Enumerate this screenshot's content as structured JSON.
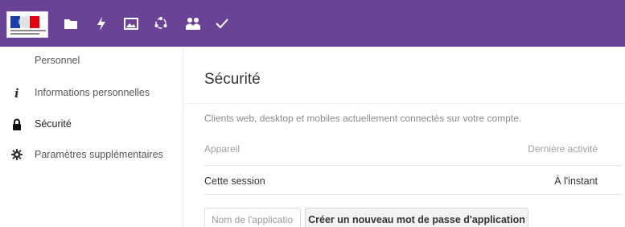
{
  "header": {
    "brand_color": "#6b4396",
    "icons": [
      "logo-republique-francaise",
      "folder-icon",
      "lightning-icon",
      "image-icon",
      "circle-nodes-icon",
      "contacts-icon",
      "checkmark-icon"
    ]
  },
  "sidebar": {
    "heading": "Personnel",
    "items": [
      {
        "icon": "info-icon",
        "label": "Informations personnelles",
        "active": false
      },
      {
        "icon": "lock-icon",
        "label": "Sécurité",
        "active": true
      },
      {
        "icon": "gear-icon",
        "label": "Paramètres supplémentaires",
        "active": false
      }
    ]
  },
  "main": {
    "title": "Sécurité",
    "description": "Clients web, desktop et mobiles actuellement connectés sur votre compte.",
    "table": {
      "headers": [
        "Appareil",
        "Dernière activité"
      ],
      "rows": [
        [
          "Cette session",
          "À l'instant"
        ]
      ]
    },
    "app_password": {
      "placeholder": "Nom de l'application",
      "button_label": "Créer un nouveau mot de passe d'application"
    }
  }
}
